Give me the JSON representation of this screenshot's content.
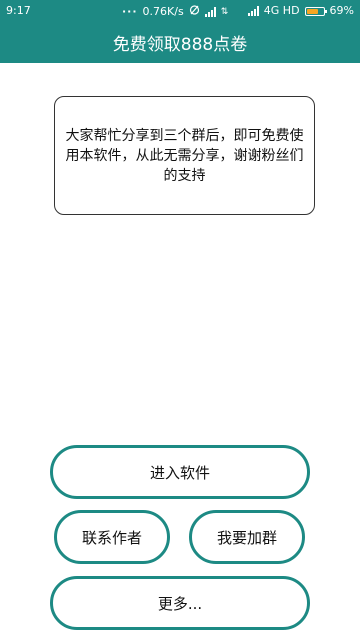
{
  "status_bar": {
    "time": "9:17",
    "network_speed": "0.76K/s",
    "network_type": "4G HD",
    "battery_percent": "69%",
    "battery_level": 0.69,
    "icons": [
      "more-dots-icon",
      "alarm-icon",
      "signal-icon",
      "data-arrows-icon",
      "signal-icon",
      "battery-icon"
    ]
  },
  "app_bar": {
    "title": "免费领取888点卷"
  },
  "notice": {
    "text": "大家帮忙分享到三个群后，即可免费使用本软件，从此无需分享，谢谢粉丝们的支持"
  },
  "buttons": {
    "enter": "进入软件",
    "contact": "联系作者",
    "join_group": "我要加群",
    "more": "更多..."
  },
  "colors": {
    "accent": "#1d8a84",
    "battery": "#f6a623"
  }
}
